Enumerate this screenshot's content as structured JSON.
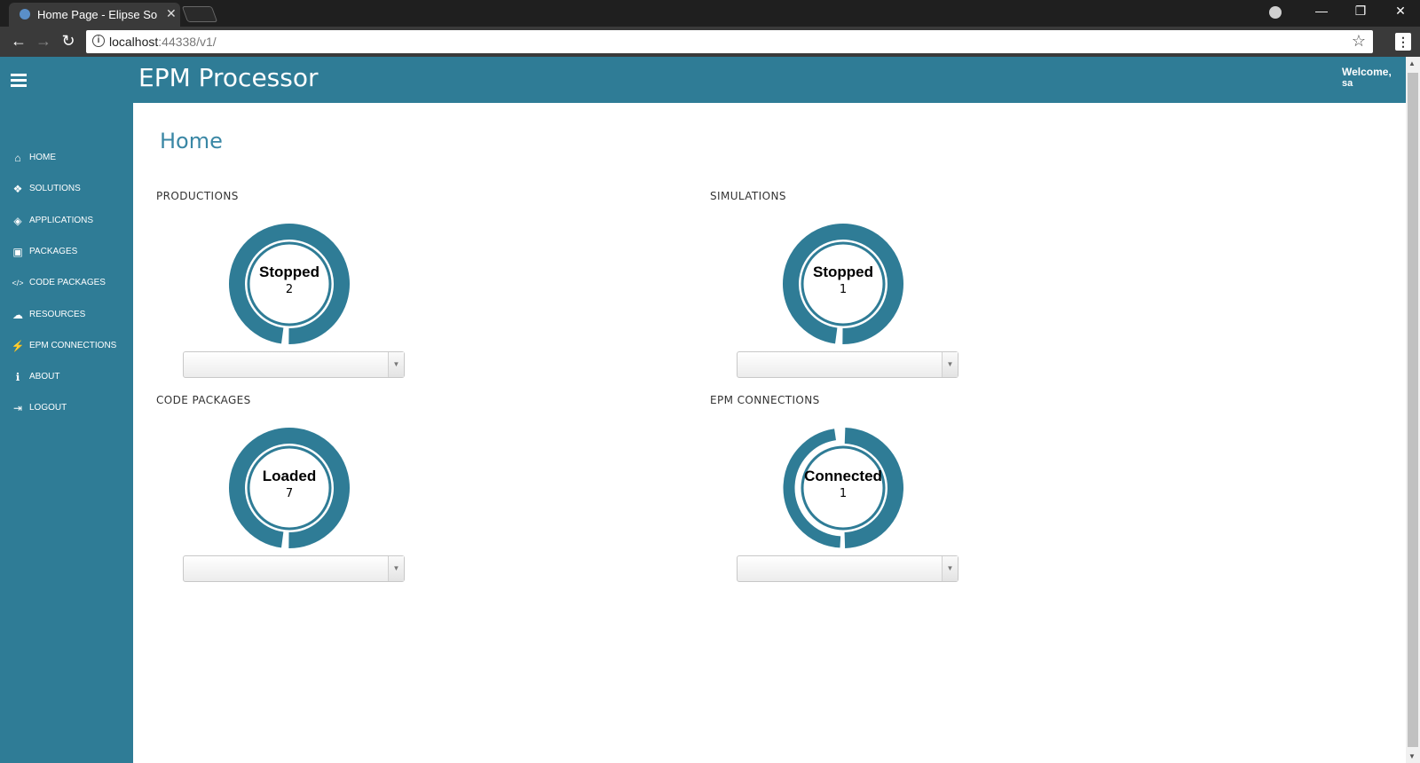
{
  "browser": {
    "tab_title": "Home Page - Elipse Software",
    "tab_close": "✕",
    "url_host": "localhost",
    "url_rest": ":44338/v1/",
    "back": "←",
    "forward": "→",
    "reload": "↻",
    "star": "☆",
    "menu": "⋮",
    "minimize": "—",
    "restore": "❐",
    "close": "✕"
  },
  "app": {
    "title": "EPM Processor",
    "welcome_label": "Welcome,",
    "welcome_user": "sa"
  },
  "sidebar": {
    "items": [
      {
        "label": "HOME",
        "icon": "home-icon",
        "glyph": "⌂"
      },
      {
        "label": "SOLUTIONS",
        "icon": "cubes-icon",
        "glyph": "❖"
      },
      {
        "label": "APPLICATIONS",
        "icon": "cube-icon",
        "glyph": "◈"
      },
      {
        "label": "PACKAGES",
        "icon": "briefcase-icon",
        "glyph": "▣"
      },
      {
        "label": "CODE PACKAGES",
        "icon": "code-icon",
        "glyph": "</>"
      },
      {
        "label": "RESOURCES",
        "icon": "cloud-icon",
        "glyph": "☁"
      },
      {
        "label": "EPM CONNECTIONS",
        "icon": "plug-icon",
        "glyph": "⚡"
      },
      {
        "label": "ABOUT",
        "icon": "info-icon",
        "glyph": "ℹ"
      },
      {
        "label": "LOGOUT",
        "icon": "sign-out-icon",
        "glyph": "⇥"
      }
    ]
  },
  "main": {
    "page_title": "Home",
    "sections": [
      {
        "label": "PRODUCTIONS",
        "status": "Stopped",
        "count": "2",
        "fraction": 0.98
      },
      {
        "label": "SIMULATIONS",
        "status": "Stopped",
        "count": "1",
        "fraction": 0.98
      },
      {
        "label": "CODE PACKAGES",
        "status": "Loaded",
        "count": "7",
        "fraction": 0.98
      },
      {
        "label": "EPM CONNECTIONS",
        "status": "Connected",
        "count": "1",
        "fraction": 0.5
      }
    ]
  },
  "colors": {
    "accent": "#2f7c96",
    "title_blue": "#3a87a5"
  }
}
